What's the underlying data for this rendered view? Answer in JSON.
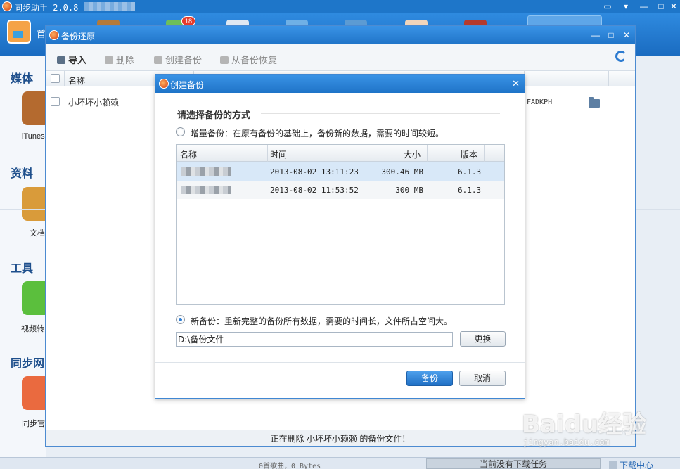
{
  "app": {
    "title": "同步助手 2.0.8 -",
    "toolbar": {
      "home_label": "首",
      "badge_count": "18"
    },
    "left_panel": {
      "sections": [
        {
          "heading": "媒体",
          "item_label": "iTunes"
        },
        {
          "heading": "资料",
          "item_label": "文档"
        },
        {
          "heading": "工具",
          "item_label": "视频转"
        },
        {
          "heading": "同步网",
          "item_label": "同步官"
        }
      ]
    },
    "statusbar": {
      "songs": "0首歌曲，0 Bytes",
      "download_status": "当前没有下载任务",
      "download_center": "下载中心"
    }
  },
  "backup_window": {
    "title": "备份还原",
    "tools": {
      "import": "导入",
      "delete": "删除",
      "create": "创建备份",
      "restore": "从备份恢复"
    },
    "table": {
      "col_name": "名称",
      "rows": [
        {
          "name": "小坏坏小赖赖",
          "serial": "FADKPH"
        }
      ]
    },
    "status": "正在删除 小坏坏小赖赖 的备份文件！"
  },
  "dialog": {
    "title": "创建备份",
    "close_glyph": "✕",
    "heading": "请选择备份的方式",
    "incremental": {
      "label": "增量备份：在原有备份的基础上，备份新的数据，需要的时间较短。",
      "selected": false,
      "columns": {
        "name": "名称",
        "time": "时间",
        "size": "大小",
        "version": "版本"
      },
      "rows": [
        {
          "time": "2013-08-02 13:11:23",
          "size": "300.46 MB",
          "version": "6.1.3"
        },
        {
          "time": "2013-08-02 11:53:52",
          "size": "300 MB",
          "version": "6.1.3"
        }
      ]
    },
    "full": {
      "label": "新备份：重新完整的备份所有数据，需要的时间长，文件所占空间大。",
      "selected": true
    },
    "path_value": "D:\\备份文件",
    "change_button": "更换",
    "backup_button": "备份",
    "cancel_button": "取消"
  },
  "watermark": {
    "main": "Baidu经验",
    "url": "jingyan.baidu.com"
  },
  "colors": {
    "title_blue": "#1f74c8",
    "accent": "#2f7fd6",
    "panel_bg": "#f4f7fb"
  }
}
